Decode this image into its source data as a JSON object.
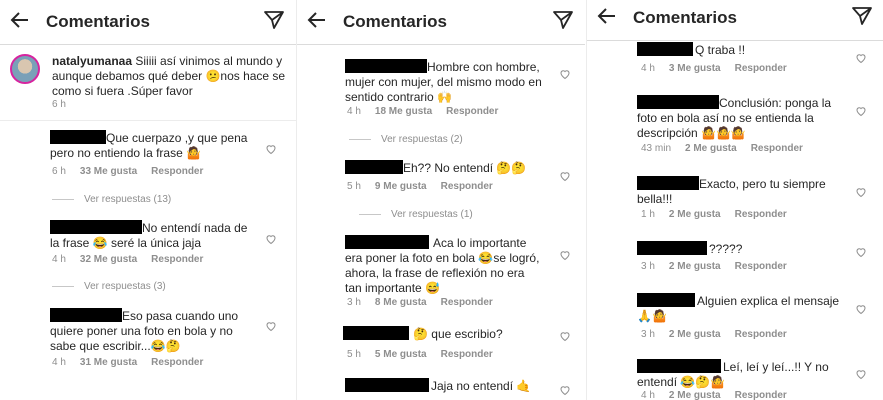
{
  "header": {
    "title": "Comentarios"
  },
  "actions": {
    "like": "Me gusta",
    "reply": "Responder"
  },
  "panel1": {
    "caption": {
      "username": "natalyumanaa",
      "text": " Siiiii así vinimos al mundo y aunque debamos qué deber 😕nos hace se como si fuera .Súper favor",
      "time": "6 h"
    },
    "comments": [
      {
        "text": "Que cuerpazo ,y que pena pero no entiendo la frase 🤷",
        "time": "6 h",
        "likes": "33 Me gusta",
        "replies": "Ver respuestas (13)"
      },
      {
        "text": "No entendí nada de la frase 😂 seré la única jaja",
        "time": "4 h",
        "likes": "32 Me gusta",
        "replies": "Ver respuestas (3)"
      },
      {
        "text": "Eso pasa cuando uno quiere poner una foto en bola y no sabe que escribir...😂🤔",
        "time": "4 h",
        "likes": "31 Me gusta"
      }
    ]
  },
  "panel2": {
    "comments": [
      {
        "text": "Hombre con hombre, mujer con mujer, del mismo modo en sentido contrario 🙌",
        "time": "4 h",
        "likes": "18 Me gusta",
        "replies": "Ver respuestas (2)"
      },
      {
        "text": "Eh?? No entendí 🤔🤔",
        "time": "5 h",
        "likes": "9 Me gusta",
        "replies": "Ver respuestas (1)"
      },
      {
        "text": "Aca lo importante era poner la foto en bola 😂se logró, ahora, la frase de reflexión no era tan importante 😅",
        "time": "3 h",
        "likes": "8 Me gusta"
      },
      {
        "text": "🤔 que escribio?",
        "time": "5 h",
        "likes": "5 Me gusta"
      },
      {
        "text": "Jaja no entendí 🤙",
        "time": ""
      }
    ]
  },
  "panel3": {
    "comments": [
      {
        "text": "Q traba !!",
        "time": "4 h",
        "likes": "3 Me gusta"
      },
      {
        "text": "Conclusión: ponga la foto en bola así no se entienda la descripción 🤷🤷🤷",
        "time": "43 min",
        "likes": "2 Me gusta"
      },
      {
        "text": "Exacto, pero tu siempre bella!!!",
        "time": "1 h",
        "likes": "2 Me gusta"
      },
      {
        "text": "?????",
        "time": "3 h",
        "likes": "2 Me gusta"
      },
      {
        "text": "Alguien explica el mensaje 🙏🤷",
        "time": "3 h",
        "likes": "2 Me gusta"
      },
      {
        "text": "Leí, leí y leí...!! Y no entendí 😂🤔🤷",
        "time": "4 h",
        "likes": "2 Me gusta"
      }
    ]
  }
}
